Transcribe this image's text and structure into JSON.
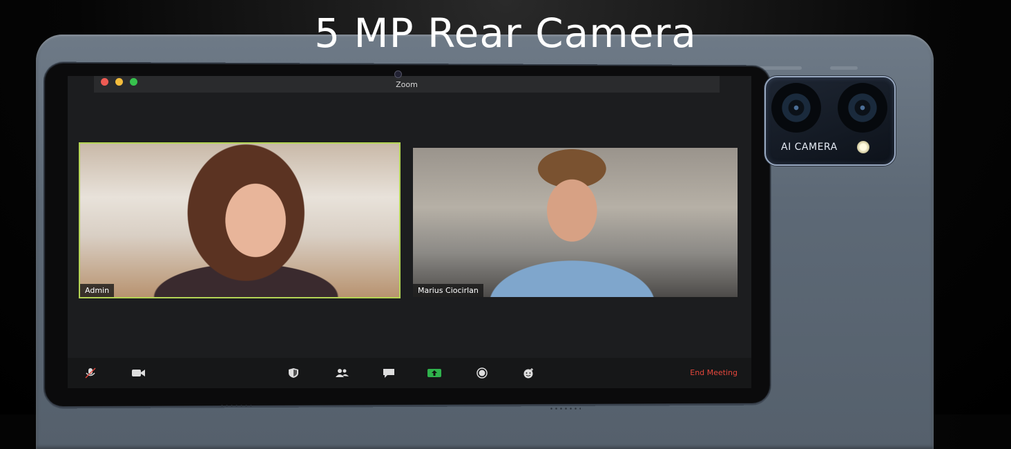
{
  "headline": "5 MP Rear Camera",
  "zoom_window": {
    "title": "Zoom",
    "participants": [
      {
        "name": "Admin",
        "active_speaker": true
      },
      {
        "name": "Marius Ciocirlan",
        "active_speaker": false
      }
    ],
    "toolbar": {
      "icons": [
        "mute-microphone-icon",
        "video-icon",
        "security-shield-icon",
        "participants-icon",
        "chat-icon",
        "share-screen-icon",
        "record-icon",
        "reactions-icon"
      ],
      "end_meeting_label": "End Meeting"
    }
  },
  "camera_module": {
    "label": "AI  CAMERA"
  },
  "colors": {
    "active_speaker_border": "#b4d455",
    "end_meeting": "#e5473c",
    "share_green": "#2fb24c",
    "tablet_body": "#5d6976"
  }
}
